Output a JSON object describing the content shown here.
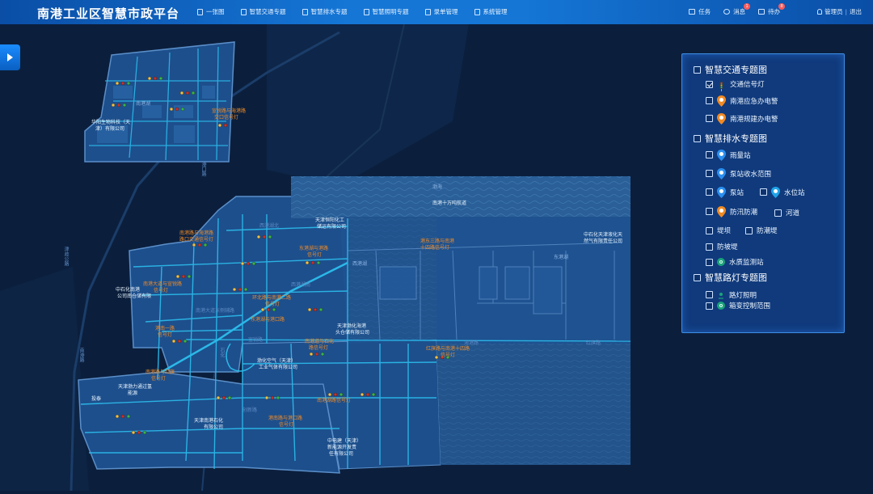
{
  "app": {
    "title": "南港工业区智慧市政平台"
  },
  "nav": [
    {
      "label": "一张图",
      "icon": "map-icon"
    },
    {
      "label": "智慧交通专题",
      "icon": "traffic-icon"
    },
    {
      "label": "智慧排水专题",
      "icon": "drainage-icon"
    },
    {
      "label": "智慧照明专题",
      "icon": "lighting-icon"
    },
    {
      "label": "录单管理",
      "icon": "document-icon"
    },
    {
      "label": "系统管理",
      "icon": "settings-icon"
    }
  ],
  "tools": {
    "task": "任务",
    "message": "消息",
    "message_badge": "1",
    "todo": "待办",
    "todo_badge": "8",
    "user": "管理员",
    "separator": "|",
    "logout": "退出"
  },
  "legend": {
    "traffic_title": "智慧交通专题图",
    "traffic_items": [
      "交通信号灯",
      "南港应急办电警",
      "南港规建办电警"
    ],
    "drainage_title": "智慧排水专题图",
    "drainage_items": [
      "雨量站",
      "泵站收水范围",
      "泵站",
      "水位站",
      "防汛防潮",
      "河道",
      "堤坝",
      "防潮堤",
      "防坡堤",
      "水质监测站"
    ],
    "lighting_title": "智慧路灯专题图",
    "lighting_items": [
      "路灯照明",
      "箱变控制范围"
    ]
  },
  "legend_state": {
    "traffic_light_checked": true
  },
  "colors": {
    "accent": "#1576d6",
    "map_bg": "#0b1f3d",
    "zone_fill": "#1d4f8c",
    "sea": "#2a5f97",
    "road": "#2bb8e8",
    "label_orange": "#f08a24",
    "pin_orange": "#f08a24",
    "pin_blue": "#2b8ff0",
    "monitor_green": "#1aa37a"
  },
  "map": {
    "labels": [
      "渤海",
      "南港十万吨航道",
      "天津恒阳化工",
      "储运有限公司",
      "西港湖",
      "东港湖",
      "中石化天津液化天",
      "然气有限责任公司",
      "红旗路",
      "海港路",
      "渤化空气（天津）",
      "工业气体有限公司",
      "天津渤化海港",
      "头仓储有限公司",
      "中电建（天津）",
      "新能源开发责",
      "任有限公司",
      "华阳生物科技（天",
      "津）有限公司",
      "天津渤力通过氢",
      "能源",
      "投泰",
      "津歧公路",
      "港口路",
      "南港大道东侧辅路",
      "西港湖南",
      "西港湖北",
      "宣锐路",
      "南港路",
      "中石化南港",
      "公司南仓储有限",
      "天津南港石化",
      "有限公司",
      "创新路",
      "石化",
      "南港湖"
    ],
    "traffic_labels": [
      "南港路与海港路",
      "路口交通信号灯",
      "宣锐路与海港路",
      "交口信号灯",
      "东港湖与港路",
      "信号灯",
      "港东三路与南港",
      "十四路信号灯",
      "环北路与南港二路",
      "信号灯",
      "红旗路与南港十四路",
      "信号灯",
      "南港道与石化",
      "路信号灯",
      "港南路与港口路",
      "信号灯",
      "南港路与红旗",
      "信号灯",
      "港南一路",
      "信号灯",
      "南港大道与宣锐路",
      "信号灯",
      "南港湖路信号灯",
      "东港湖与港口路"
    ]
  }
}
